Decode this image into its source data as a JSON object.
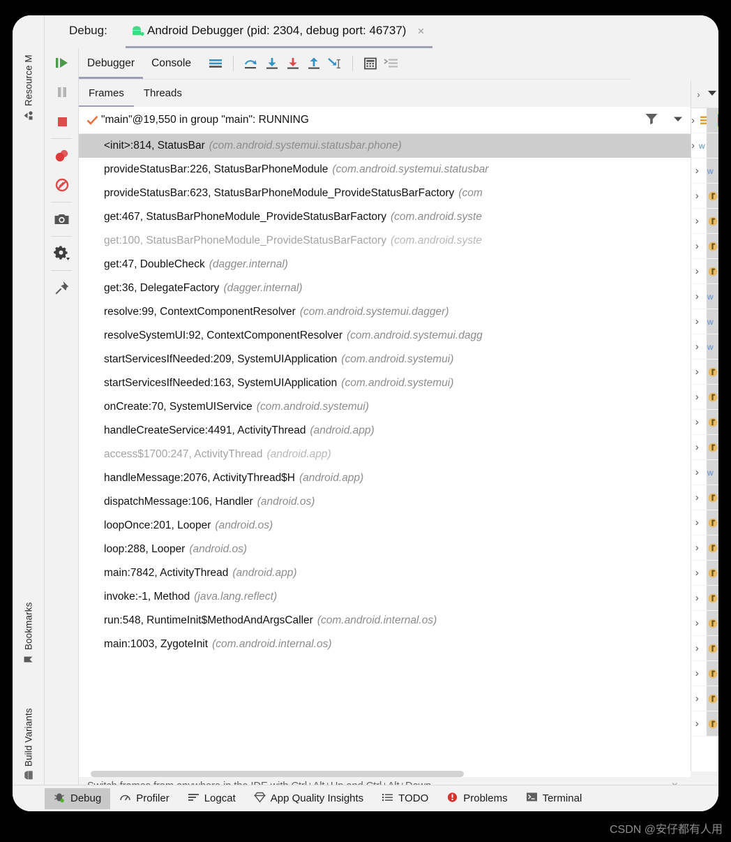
{
  "window": {
    "title_prefix": "Debug:",
    "session_tab": {
      "label": "Android Debugger (pid: 2304, debug port: 46737)",
      "close": "×",
      "icon": "android-icon"
    }
  },
  "left_strip": {
    "top_labels": [
      {
        "label": "Resource M",
        "icon": "resource-manager-icon"
      }
    ],
    "bottom_labels": [
      {
        "label": "Bookmarks",
        "icon": "bookmark-icon"
      },
      {
        "label": "Build Variants",
        "icon": "android-icon"
      }
    ]
  },
  "run_controls": [
    {
      "name": "resume-program-button",
      "icon": "resume-icon",
      "color": "#4a9a4a"
    },
    {
      "name": "pause-program-button",
      "icon": "pause-icon",
      "color": "#b0b0b0"
    },
    {
      "name": "stop-button",
      "icon": "stop-icon",
      "color": "#db4a4a"
    },
    {
      "name": "view-breakpoints-button",
      "icon": "breakpoints-icon",
      "color": "#db4a4a"
    },
    {
      "name": "mute-breakpoints-button",
      "icon": "mute-breakpoints-icon",
      "color": "#db4a4a"
    },
    {
      "name": "screenshot-button",
      "icon": "camera-icon",
      "color": "#5a5a5a"
    },
    {
      "name": "settings-button",
      "icon": "gear-icon",
      "color": "#3c3c3c"
    },
    {
      "name": "pin-tab-button",
      "icon": "pin-icon",
      "color": "#5a5a5a"
    }
  ],
  "toolbar": {
    "tabs": [
      {
        "label": "Debugger",
        "active": true
      },
      {
        "label": "Console",
        "active": false
      }
    ],
    "actions": [
      {
        "name": "show-execution-point-button",
        "icon": "execution-point-icon"
      },
      {
        "name": "step-over-button",
        "icon": "step-over-icon"
      },
      {
        "name": "step-into-button",
        "icon": "step-into-icon"
      },
      {
        "name": "force-step-into-button",
        "icon": "force-step-into-icon"
      },
      {
        "name": "step-out-button",
        "icon": "step-out-icon"
      },
      {
        "name": "run-to-cursor-button",
        "icon": "run-to-cursor-icon"
      },
      {
        "name": "evaluate-expression-button",
        "icon": "calculator-icon"
      },
      {
        "name": "layout-settings-button",
        "icon": "layout-icon"
      }
    ]
  },
  "subtabs": [
    {
      "label": "Frames",
      "active": true
    },
    {
      "label": "Threads",
      "active": false
    }
  ],
  "thread_header": {
    "status_icon": "check-icon",
    "text": "\"main\"@19,550 in group \"main\": RUNNING",
    "filter_icon": "filter-icon",
    "dropdown_icon": "chevron-down-icon"
  },
  "frames": [
    {
      "method": "<init>:814, StatusBar",
      "pkg": "(com.android.systemui.statusbar.phone)",
      "selected": true,
      "dim": false
    },
    {
      "method": "provideStatusBar:226, StatusBarPhoneModule",
      "pkg": "(com.android.systemui.statusbar",
      "selected": false,
      "dim": false
    },
    {
      "method": "provideStatusBar:623, StatusBarPhoneModule_ProvideStatusBarFactory",
      "pkg": "(com",
      "selected": false,
      "dim": false
    },
    {
      "method": "get:467, StatusBarPhoneModule_ProvideStatusBarFactory",
      "pkg": "(com.android.syste",
      "selected": false,
      "dim": false
    },
    {
      "method": "get:100, StatusBarPhoneModule_ProvideStatusBarFactory",
      "pkg": "(com.android.syste",
      "selected": false,
      "dim": true
    },
    {
      "method": "get:47, DoubleCheck",
      "pkg": "(dagger.internal)",
      "selected": false,
      "dim": false
    },
    {
      "method": "get:36, DelegateFactory",
      "pkg": "(dagger.internal)",
      "selected": false,
      "dim": false
    },
    {
      "method": "resolve:99, ContextComponentResolver",
      "pkg": "(com.android.systemui.dagger)",
      "selected": false,
      "dim": false
    },
    {
      "method": "resolveSystemUI:92, ContextComponentResolver",
      "pkg": "(com.android.systemui.dagg",
      "selected": false,
      "dim": false
    },
    {
      "method": "startServicesIfNeeded:209, SystemUIApplication",
      "pkg": "(com.android.systemui)",
      "selected": false,
      "dim": false
    },
    {
      "method": "startServicesIfNeeded:163, SystemUIApplication",
      "pkg": "(com.android.systemui)",
      "selected": false,
      "dim": false
    },
    {
      "method": "onCreate:70, SystemUIService",
      "pkg": "(com.android.systemui)",
      "selected": false,
      "dim": false
    },
    {
      "method": "handleCreateService:4491, ActivityThread",
      "pkg": "(android.app)",
      "selected": false,
      "dim": false
    },
    {
      "method": "access$1700:247, ActivityThread",
      "pkg": "(android.app)",
      "selected": false,
      "dim": true
    },
    {
      "method": "handleMessage:2076, ActivityThread$H",
      "pkg": "(android.app)",
      "selected": false,
      "dim": false
    },
    {
      "method": "dispatchMessage:106, Handler",
      "pkg": "(android.os)",
      "selected": false,
      "dim": false
    },
    {
      "method": "loopOnce:201, Looper",
      "pkg": "(android.os)",
      "selected": false,
      "dim": false
    },
    {
      "method": "loop:288, Looper",
      "pkg": "(android.os)",
      "selected": false,
      "dim": false
    },
    {
      "method": "main:7842, ActivityThread",
      "pkg": "(android.app)",
      "selected": false,
      "dim": false
    },
    {
      "method": "invoke:-1, Method",
      "pkg": "(java.lang.reflect)",
      "selected": false,
      "dim": false
    },
    {
      "method": "run:548, RuntimeInit$MethodAndArgsCaller",
      "pkg": "(com.android.internal.os)",
      "selected": false,
      "dim": false
    },
    {
      "method": "main:1003, ZygoteInit",
      "pkg": "(com.android.internal.os)",
      "selected": false,
      "dim": false
    }
  ],
  "hint": {
    "text": "Switch frames from anywhere in the IDE with Ctrl+Alt+Up and Ctrl+Alt+Down",
    "close": "×"
  },
  "variables_panel": {
    "header_icon": "chevron-down-icon",
    "rows": [
      {
        "arrow": "›",
        "icon": "array-icon",
        "checkbox": true,
        "marker": "red-dot"
      },
      {
        "arrow": "›",
        "icon": "watch-icon",
        "checkbox": true,
        "marker": "orange-bar"
      },
      {
        "arrow": "›",
        "icon": "watch-icon",
        "checkbox": false,
        "marker": ""
      },
      {
        "arrow": "›",
        "icon": "field-icon",
        "checkbox": false,
        "marker": ""
      },
      {
        "arrow": "›",
        "icon": "field-icon",
        "checkbox": false,
        "marker": ""
      },
      {
        "arrow": "›",
        "icon": "field-icon",
        "checkbox": false,
        "marker": ""
      },
      {
        "arrow": "›",
        "icon": "field-icon",
        "checkbox": false,
        "marker": ""
      },
      {
        "arrow": "›",
        "icon": "watch-icon",
        "checkbox": false,
        "marker": ""
      },
      {
        "arrow": "›",
        "icon": "watch-icon",
        "checkbox": false,
        "marker": ""
      },
      {
        "arrow": "›",
        "icon": "watch-icon",
        "checkbox": false,
        "marker": ""
      },
      {
        "arrow": "›",
        "icon": "field-icon",
        "checkbox": false,
        "marker": ""
      },
      {
        "arrow": "›",
        "icon": "field-icon",
        "checkbox": false,
        "marker": ""
      },
      {
        "arrow": "›",
        "icon": "field-icon",
        "checkbox": false,
        "marker": ""
      },
      {
        "arrow": "›",
        "icon": "field-icon",
        "checkbox": false,
        "marker": ""
      },
      {
        "arrow": "›",
        "icon": "watch-icon",
        "checkbox": false,
        "marker": ""
      },
      {
        "arrow": "›",
        "icon": "field-icon",
        "checkbox": false,
        "marker": ""
      },
      {
        "arrow": "›",
        "icon": "field-icon",
        "checkbox": false,
        "marker": ""
      },
      {
        "arrow": "›",
        "icon": "field-icon",
        "checkbox": false,
        "marker": ""
      },
      {
        "arrow": "›",
        "icon": "field-icon",
        "checkbox": false,
        "marker": ""
      },
      {
        "arrow": "›",
        "icon": "field-icon",
        "checkbox": false,
        "marker": ""
      },
      {
        "arrow": "›",
        "icon": "field-icon",
        "checkbox": false,
        "marker": ""
      },
      {
        "arrow": "›",
        "icon": "field-icon",
        "checkbox": false,
        "marker": ""
      },
      {
        "arrow": "›",
        "icon": "field-icon",
        "checkbox": false,
        "marker": ""
      },
      {
        "arrow": "›",
        "icon": "field-icon",
        "checkbox": false,
        "marker": ""
      },
      {
        "arrow": "›",
        "icon": "field-icon",
        "checkbox": false,
        "marker": ""
      }
    ]
  },
  "bottom_tool_windows": [
    {
      "label": "Debug",
      "icon": "debug-bug-icon",
      "active": true
    },
    {
      "label": "Profiler",
      "icon": "profiler-icon",
      "active": false
    },
    {
      "label": "Logcat",
      "icon": "logcat-icon",
      "active": false
    },
    {
      "label": "App Quality Insights",
      "icon": "diamond-icon",
      "active": false
    },
    {
      "label": "TODO",
      "icon": "todo-list-icon",
      "active": false
    },
    {
      "label": "Problems",
      "icon": "problems-icon",
      "active": false
    },
    {
      "label": "Terminal",
      "icon": "terminal-icon",
      "active": false
    }
  ],
  "watermark": "CSDN @安仔都有人用",
  "colors": {
    "accent_tab_underline": "#9ba0b5",
    "selection": "#cdcdcd",
    "checkbox_blue": "#3d85e0",
    "step_blue": "#3592c4",
    "step_red": "#db4a4a",
    "run_green": "#4a9a4a",
    "check_orange": "#e8733f"
  }
}
